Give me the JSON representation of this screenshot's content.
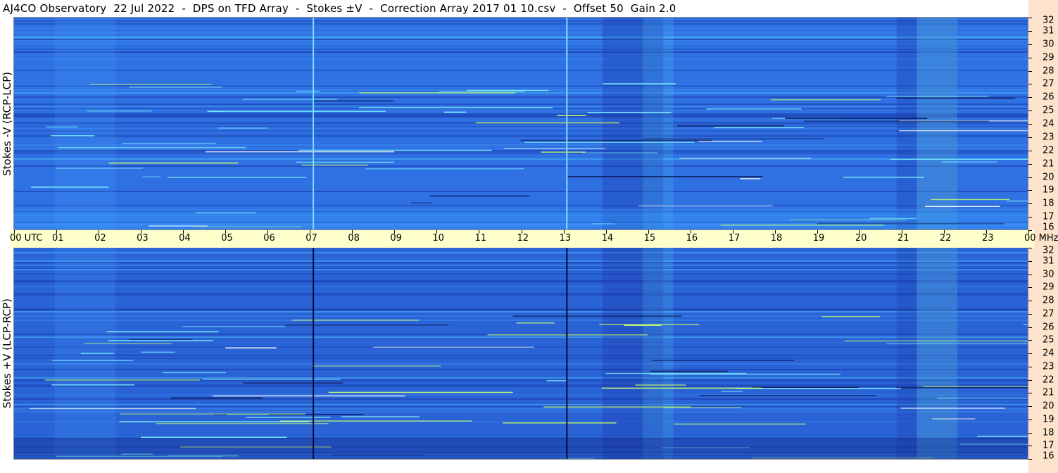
{
  "title": "AJ4CO Observatory  22 Jul 2022  -  DPS on TFD Array  -  Stokes ±V  -  Correction Array 2017 01 10.csv  -  Offset 50  Gain 2.0",
  "top_panel_label": "Stokes -V (RCP-LCP)",
  "bottom_panel_label": "Stokes +V (LCP-RCP)",
  "colors": {
    "background_blue": "#2f6fe0",
    "time_bar": "#ffffcc",
    "freq_strip": "#fde3cc"
  },
  "chart_data": {
    "type": "heatmap",
    "time_axis": {
      "label": "UTC",
      "ticks": [
        "00",
        "01",
        "02",
        "03",
        "04",
        "05",
        "06",
        "07",
        "08",
        "09",
        "10",
        "11",
        "12",
        "13",
        "14",
        "15",
        "16",
        "17",
        "18",
        "19",
        "20",
        "21",
        "22",
        "23",
        "00"
      ],
      "range_hours": [
        0,
        24
      ]
    },
    "freq_axis": {
      "unit": "MHz",
      "ticks": [
        32,
        31,
        30,
        29,
        28,
        27,
        26,
        25,
        24,
        23,
        22,
        21,
        20,
        19,
        18,
        17,
        16
      ],
      "range_mhz": [
        16,
        32
      ]
    },
    "panels": [
      {
        "name": "Stokes -V (RCP-LCP)",
        "vertical_lines_utc": [
          7.08,
          13.08
        ],
        "vertical_line_color": "#7de0ff"
      },
      {
        "name": "Stokes +V (LCP-RCP)",
        "vertical_lines_utc": [
          7.08,
          13.08
        ],
        "vertical_line_color": "#0a0a30"
      }
    ]
  }
}
